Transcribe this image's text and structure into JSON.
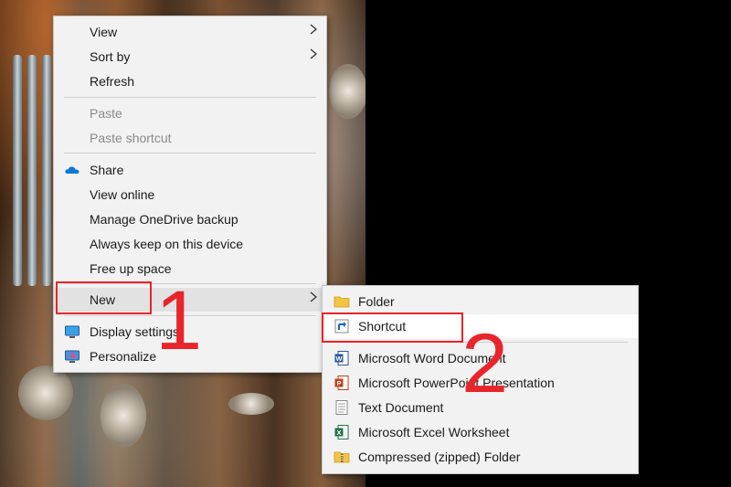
{
  "main_menu": {
    "items": [
      {
        "label": "View",
        "submenu": true
      },
      {
        "label": "Sort by",
        "submenu": true
      },
      {
        "label": "Refresh"
      },
      {
        "label": "Paste",
        "disabled": true
      },
      {
        "label": "Paste shortcut",
        "disabled": true
      },
      {
        "label": "Share",
        "icon": "onedrive-cloud-icon"
      },
      {
        "label": "View online"
      },
      {
        "label": "Manage OneDrive backup"
      },
      {
        "label": "Always keep on this device"
      },
      {
        "label": "Free up space"
      },
      {
        "label": "New",
        "submenu": true,
        "highlighted": true
      },
      {
        "label": "Display settings",
        "icon": "display-settings-icon"
      },
      {
        "label": "Personalize",
        "icon": "personalize-icon"
      }
    ]
  },
  "new_submenu": {
    "items": [
      {
        "label": "Folder",
        "icon": "folder-icon"
      },
      {
        "label": "Shortcut",
        "icon": "shortcut-icon",
        "highlighted": true
      },
      {
        "label": "Microsoft Word Document",
        "icon": "word-document-icon"
      },
      {
        "label": "Microsoft PowerPoint Presentation",
        "icon": "powerpoint-icon"
      },
      {
        "label": "Text Document",
        "icon": "text-document-icon"
      },
      {
        "label": "Microsoft Excel Worksheet",
        "icon": "excel-worksheet-icon"
      },
      {
        "label": "Compressed (zipped) Folder",
        "icon": "zipped-folder-icon"
      }
    ]
  },
  "annotations": {
    "step1": "1",
    "step2": "2"
  },
  "colors": {
    "annotation_red": "#e8252a",
    "menu_background": "#f2f2f2",
    "onedrive_blue": "#0f78d4"
  }
}
